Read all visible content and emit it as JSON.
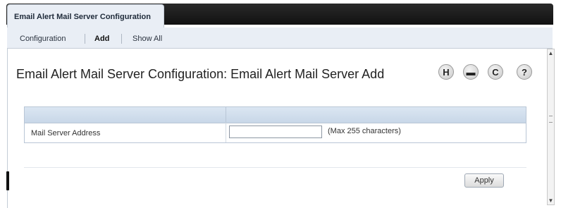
{
  "tabs": {
    "active_label": "Email Alert Mail Server Configuration"
  },
  "subnav": {
    "items": [
      {
        "label": "Configuration"
      },
      {
        "label": "Add"
      },
      {
        "label": "Show All"
      }
    ]
  },
  "page": {
    "title": "Email Alert Mail Server Configuration: Email Alert Mail Server Add"
  },
  "toolbar": {
    "save_icon": "save-icon",
    "save_glyph": "H",
    "print_icon": "print-icon",
    "print_glyph": "▬",
    "refresh_icon": "refresh-icon",
    "refresh_glyph": "C",
    "help_icon": "help-icon",
    "help_glyph": "?"
  },
  "form": {
    "field_label": "Mail Server Address",
    "field_value": "",
    "field_hint": "(Max 255 characters)"
  },
  "actions": {
    "apply_label": "Apply"
  },
  "colors": {
    "tab_strip": "#111111",
    "header_band": "#c8d7e8",
    "subnav_bg": "#e9eef5"
  }
}
